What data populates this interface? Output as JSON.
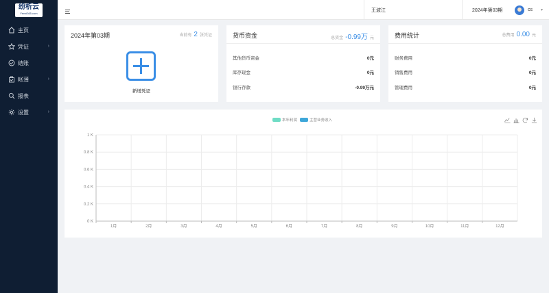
{
  "logo": {
    "name": "纷析云",
    "domain": "Fenxi365.com"
  },
  "sidebar": {
    "items": [
      {
        "label": "主页",
        "icon": "home-icon",
        "has_children": false
      },
      {
        "label": "凭证",
        "icon": "star-icon",
        "has_children": true
      },
      {
        "label": "结账",
        "icon": "check-circle-icon",
        "has_children": false
      },
      {
        "label": "帐薄",
        "icon": "ledger-icon",
        "has_children": true
      },
      {
        "label": "报表",
        "icon": "search-icon",
        "has_children": false
      },
      {
        "label": "设置",
        "icon": "gear-icon",
        "has_children": true
      }
    ]
  },
  "header": {
    "company": "王波江",
    "period": "2024年第03期",
    "user": "cs"
  },
  "voucher_card": {
    "title": "2024年第03期",
    "current_prefix": "当前有",
    "count": "2",
    "count_suffix": "张凭证",
    "add_label": "新增凭证"
  },
  "cash_card": {
    "title": "货币资金",
    "total_prefix": "总资金",
    "total": "-0.99万",
    "total_unit": "元",
    "rows": [
      {
        "label": "其他货币资金",
        "value": "0元"
      },
      {
        "label": "库存现金",
        "value": "0元"
      },
      {
        "label": "银行存款",
        "value": "-0.99万元"
      }
    ]
  },
  "expense_card": {
    "title": "费用统计",
    "total_prefix": "总费用",
    "total": "0.00",
    "total_unit": "元",
    "rows": [
      {
        "label": "财务费用",
        "value": "0元"
      },
      {
        "label": "销售费用",
        "value": "0元"
      },
      {
        "label": "管理费用",
        "value": "0元"
      }
    ]
  },
  "colors": {
    "sidebar_bg": "#0f1e33",
    "accent": "#3a8ee6",
    "series_profit": "#6fdcc5",
    "series_income": "#3ea7d9"
  },
  "chart_data": {
    "type": "bar",
    "categories": [
      "1月",
      "2月",
      "3月",
      "4月",
      "5月",
      "6月",
      "7月",
      "8月",
      "9月",
      "10月",
      "11月",
      "12月"
    ],
    "series": [
      {
        "name": "本年利润",
        "values": [
          0,
          0,
          0,
          0,
          0,
          0,
          0,
          0,
          0,
          0,
          0,
          0
        ]
      },
      {
        "name": "主营业务收入",
        "values": [
          0,
          0,
          0,
          0,
          0,
          0,
          0,
          0,
          0,
          0,
          0,
          0
        ]
      }
    ],
    "yticks": [
      "0 K",
      "0.2 K",
      "0.4 K",
      "0.6 K",
      "0.8 K",
      "1 K"
    ],
    "ylim": [
      0,
      1000
    ],
    "grid": true,
    "legend_position": "top-center"
  }
}
